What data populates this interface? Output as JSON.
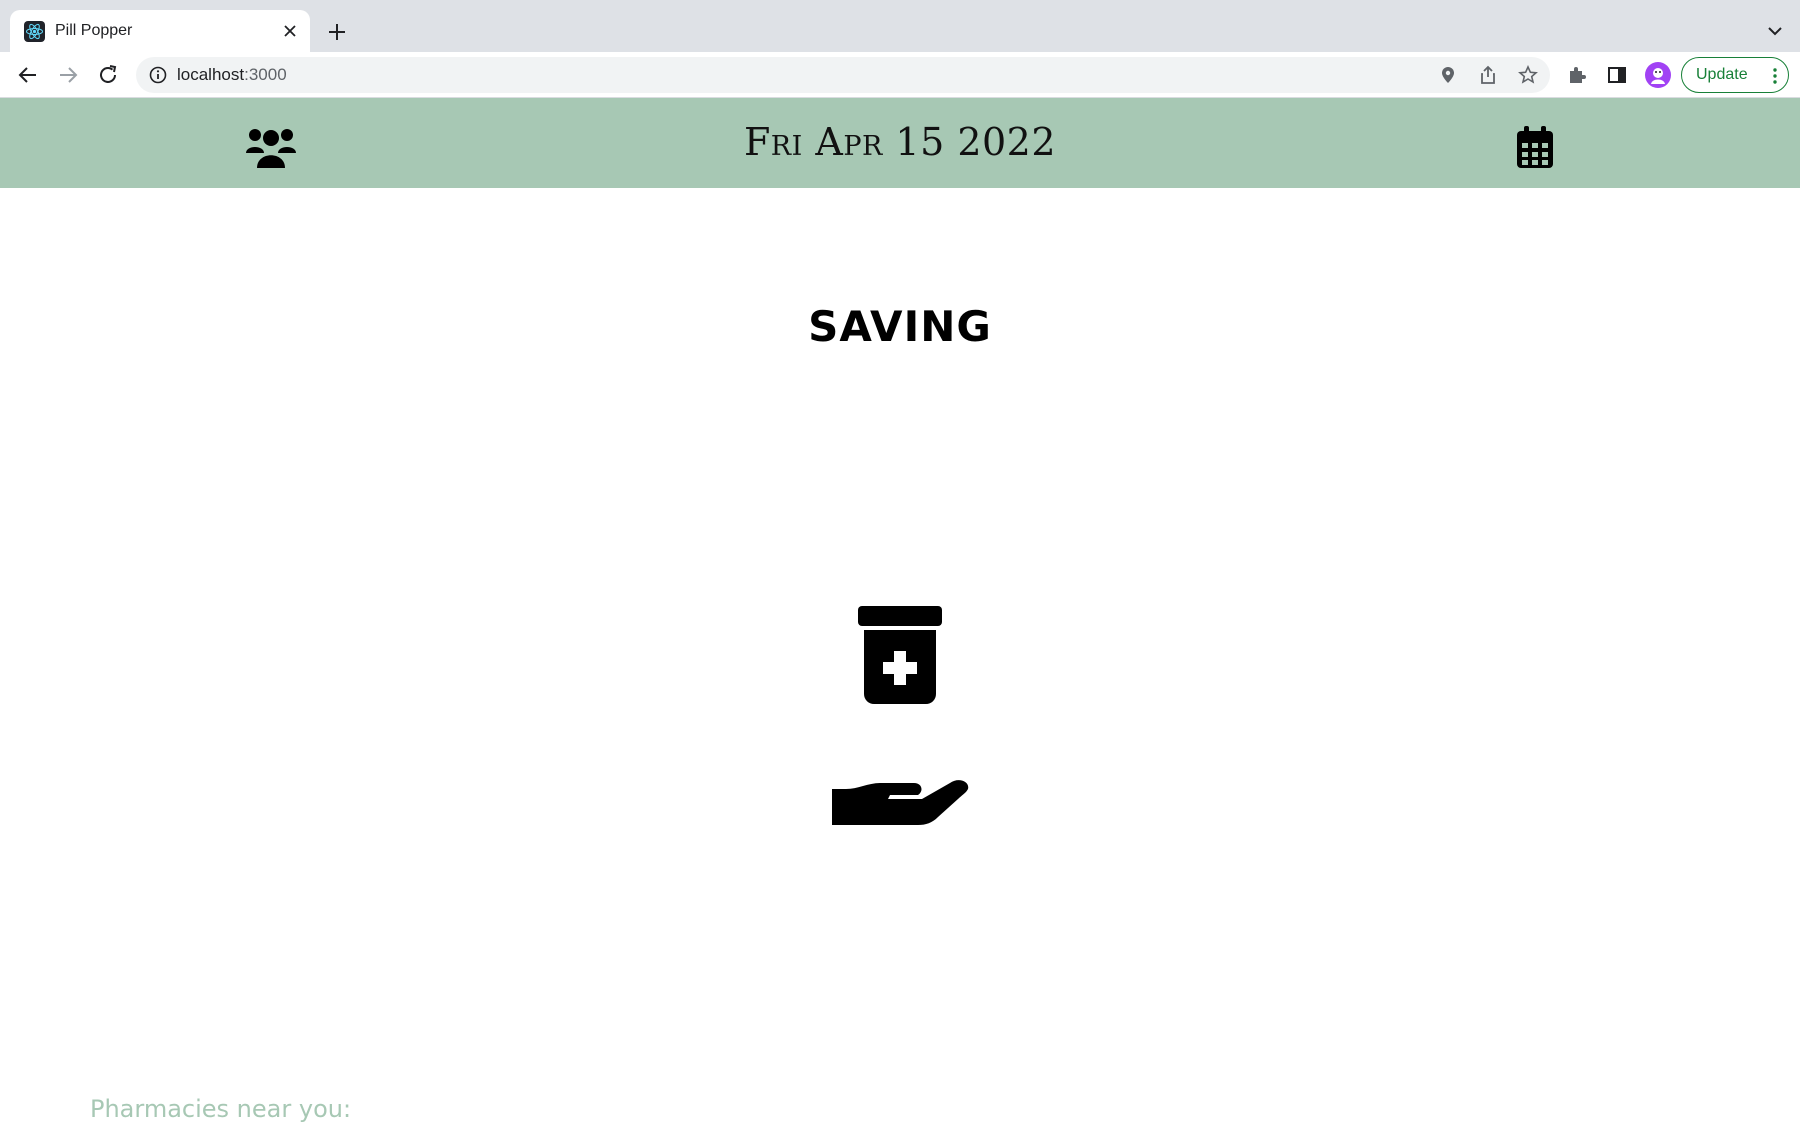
{
  "browser": {
    "tab_title": "Pill Popper",
    "url_host": "localhost",
    "url_port": ":3000",
    "update_label": "Update"
  },
  "header": {
    "date": "Fri Apr 15 2022",
    "left_icon": "users-icon",
    "right_icon": "calendar-icon",
    "bg_color": "#a7c8b4"
  },
  "main": {
    "title": "SAVING",
    "bottle_icon": "prescription-bottle-icon",
    "hand_icon": "open-hand-icon"
  },
  "pharmacies": {
    "label": "Pharmacies near you:",
    "color": "#a7c8b4"
  }
}
